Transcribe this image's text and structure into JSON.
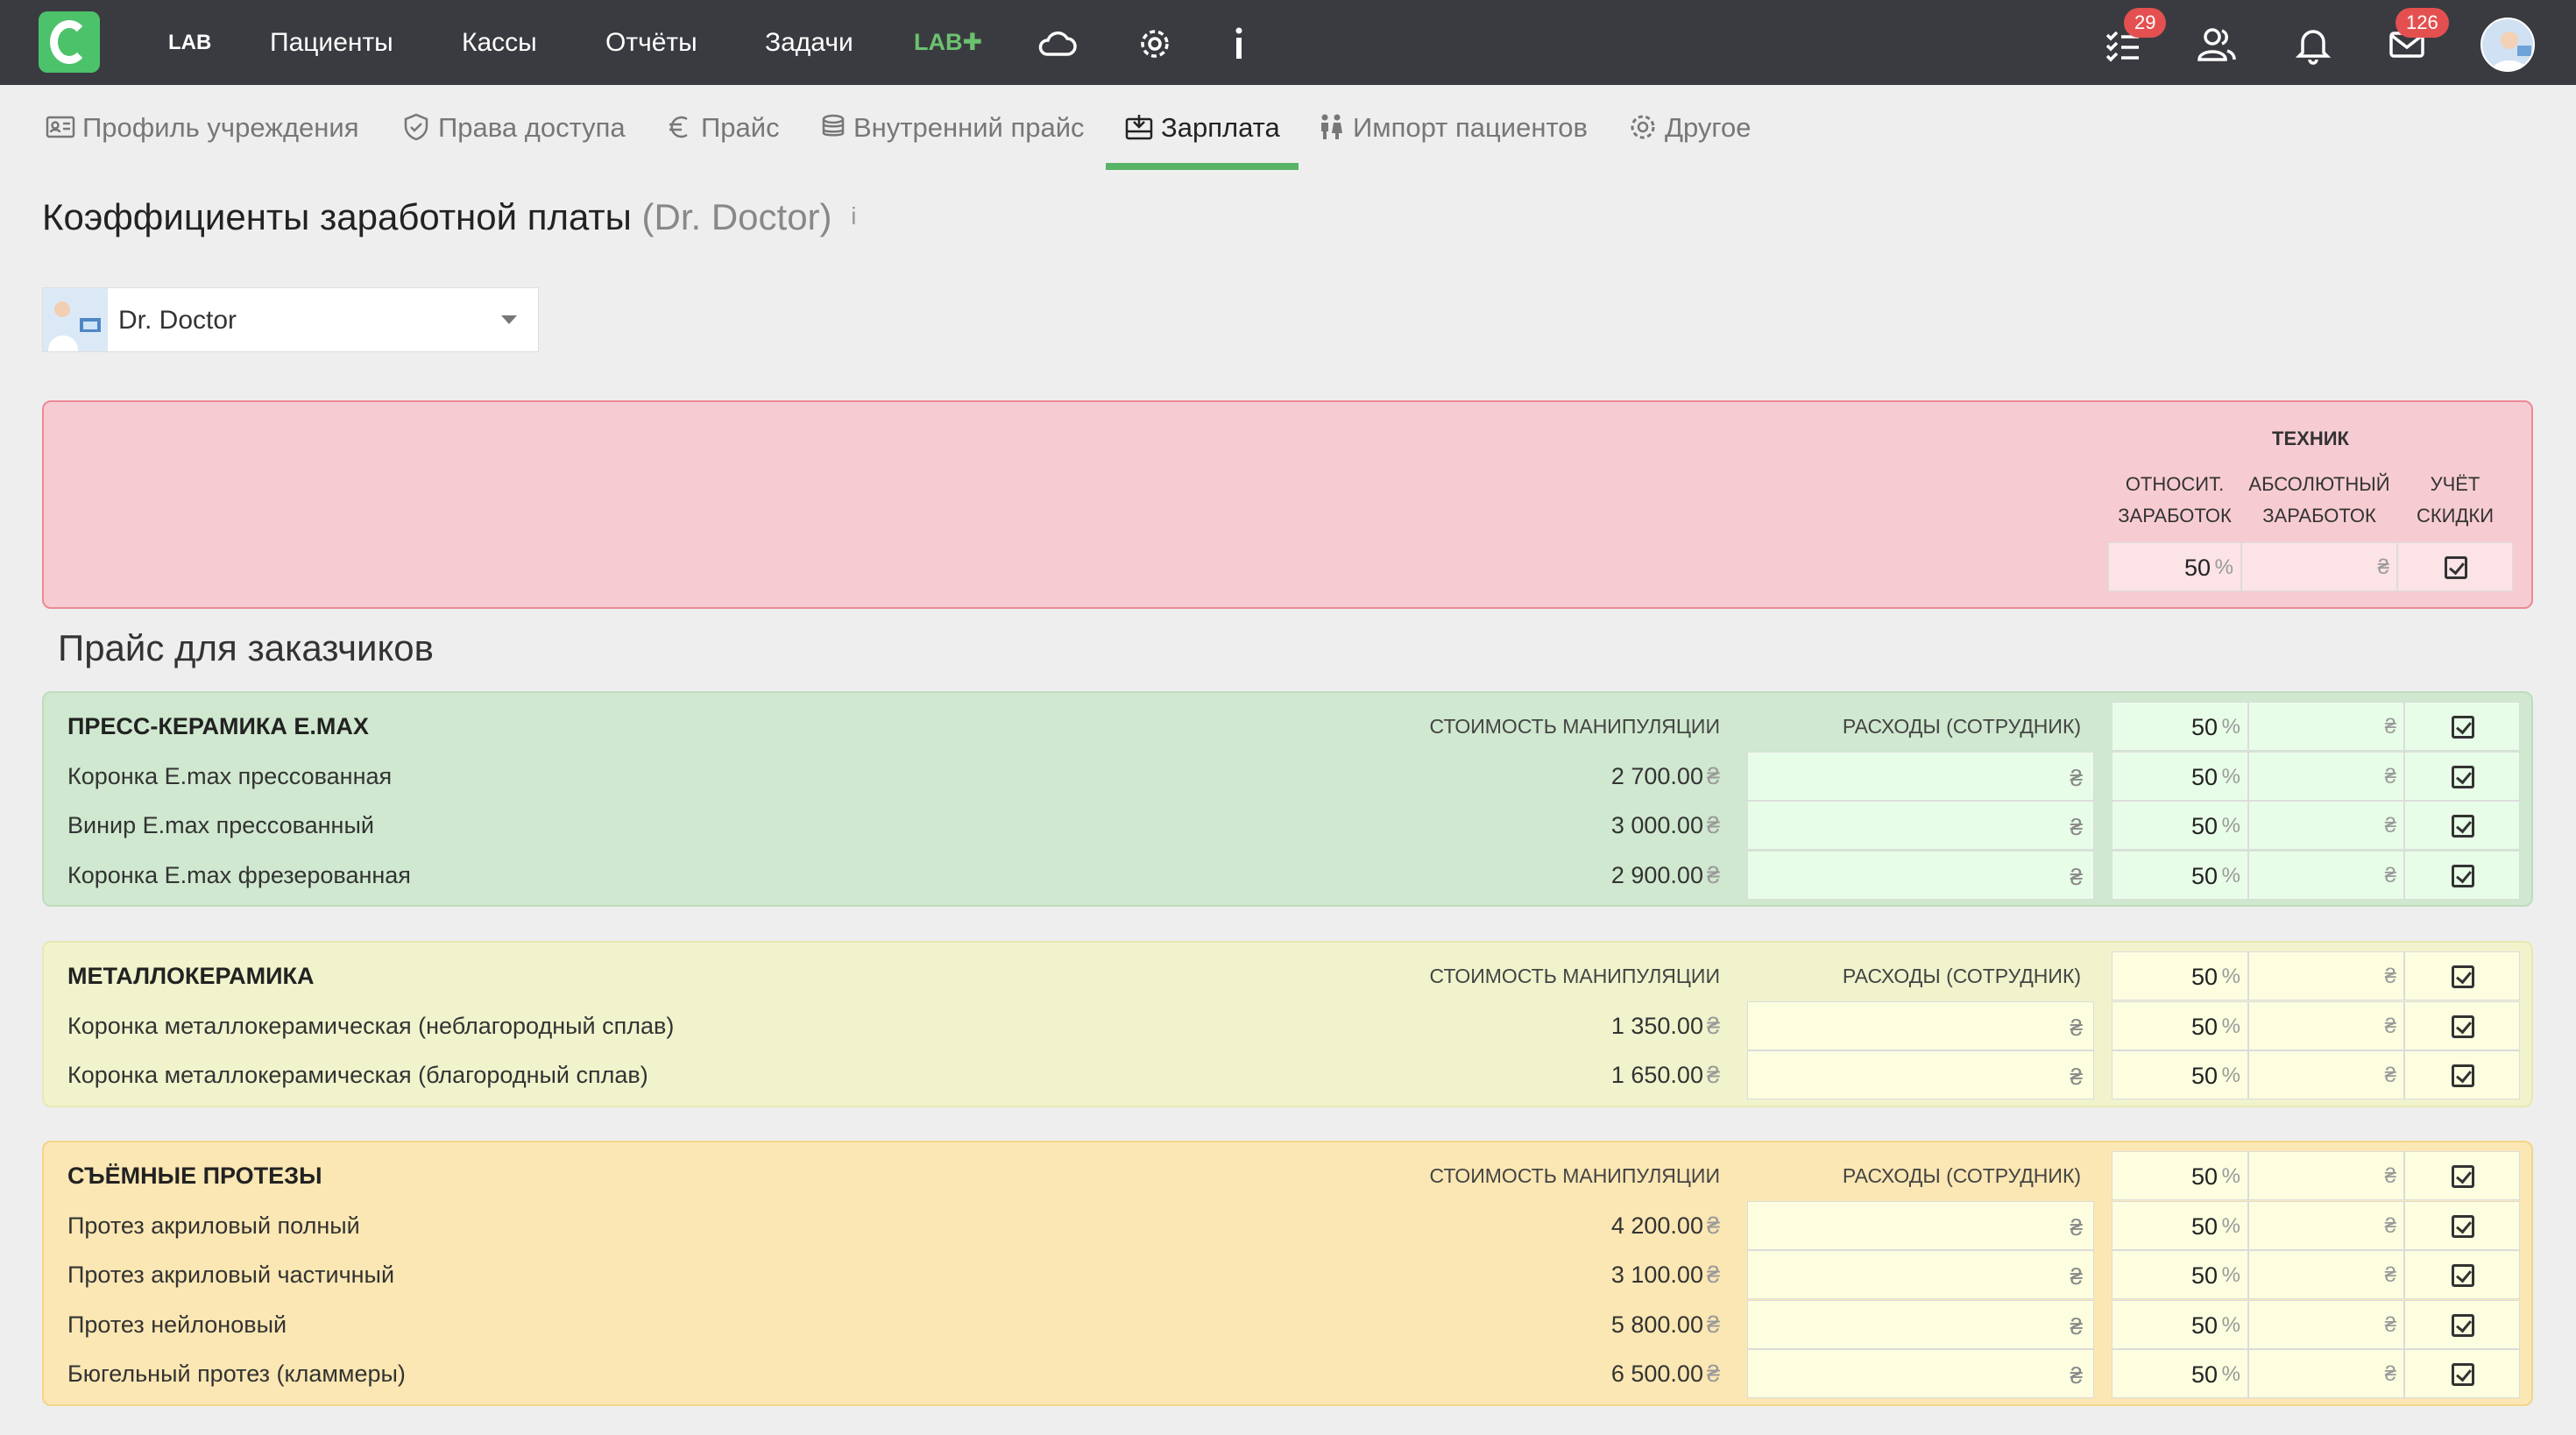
{
  "nav": {
    "lab": "LAB",
    "items": [
      "Пациенты",
      "Кассы",
      "Отчёты",
      "Задачи"
    ],
    "labplus": "LAB✚",
    "tasks_badge": "29",
    "messages_badge": "126"
  },
  "tabs": [
    {
      "label": "Профиль учреждения",
      "icon": "id-card-icon"
    },
    {
      "label": "Права доступа",
      "icon": "shield-icon"
    },
    {
      "label": "Прайс",
      "icon": "euro-icon"
    },
    {
      "label": "Внутренний прайс",
      "icon": "coins-icon"
    },
    {
      "label": "Зарплата",
      "icon": "wallet-icon",
      "active": true
    },
    {
      "label": "Импорт пациентов",
      "icon": "people-icon"
    },
    {
      "label": "Другое",
      "icon": "gear-icon"
    }
  ],
  "page": {
    "title": "Коэффициенты заработной платы",
    "subtitle": "(Dr. Doctor)",
    "info": "i"
  },
  "doctor_select": {
    "value": "Dr. Doctor"
  },
  "technician": {
    "header": "ТЕХНИК",
    "col_rel_1": "ОТНОСИТ.",
    "col_rel_2": "ЗАРАБОТОК",
    "col_abs_1": "АБСОЛЮТНЫЙ",
    "col_abs_2": "ЗАРАБОТОК",
    "col_chk_1": "УЧЁТ",
    "col_chk_2": "СКИДКИ",
    "rel_value": "50",
    "rel_unit": "%",
    "abs_unit": "₴",
    "discount_checked": true
  },
  "section_title": "Прайс для заказчиков",
  "col_cost": "СТОИМОСТЬ МАНИПУЛЯЦИИ",
  "col_expense": "РАСХОДЫ (СОТРУДНИК)",
  "currency": "₴",
  "percent": "%",
  "groups": [
    {
      "name": "ПРЕСС-КЕРАМИКА E.MAX",
      "color": "#cfe8cf",
      "head_rel": "50",
      "items": [
        {
          "name": "Коронка E.max прессованная",
          "price": "2 700.00",
          "rel": "50"
        },
        {
          "name": "Винир E.max прессованный",
          "price": "3 000.00",
          "rel": "50"
        },
        {
          "name": "Коронка E.max фрезерованная",
          "price": "2 900.00",
          "rel": "50"
        }
      ]
    },
    {
      "name": "МЕТАЛЛОКЕРАМИКА",
      "color": "#f1f3cc",
      "head_rel": "50",
      "items": [
        {
          "name": "Коронка металлокерамическая (неблагородный сплав)",
          "price": "1 350.00",
          "rel": "50"
        },
        {
          "name": "Коронка металлокерамическая (благородный сплав)",
          "price": "1 650.00",
          "rel": "50"
        }
      ]
    },
    {
      "name": "СЪЁМНЫЕ ПРОТЕЗЫ",
      "color": "#fbe7b3",
      "head_rel": "50",
      "items": [
        {
          "name": "Протез акриловый полный",
          "price": "4 200.00",
          "rel": "50"
        },
        {
          "name": "Протез акриловый частичный",
          "price": "3 100.00",
          "rel": "50"
        },
        {
          "name": "Протез нейлоновый",
          "price": "5 800.00",
          "rel": "50"
        },
        {
          "name": "Бюгельный протез (кламмеры)",
          "price": "6 500.00",
          "rel": "50"
        }
      ]
    }
  ]
}
